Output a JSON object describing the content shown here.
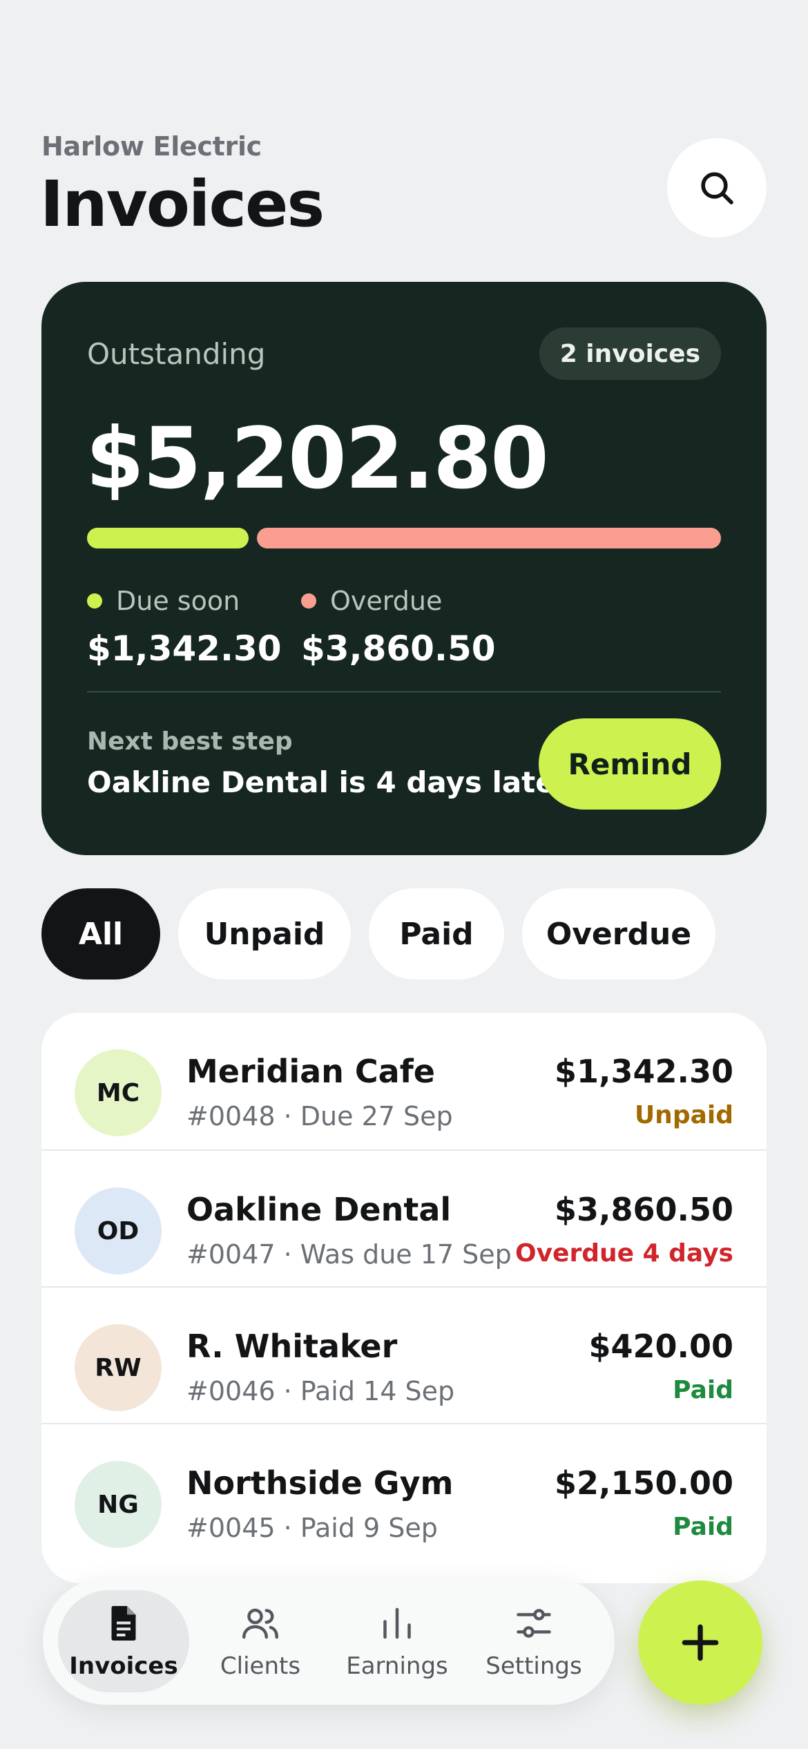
{
  "header": {
    "company": "Harlow Electric",
    "title": "Invoices",
    "search_icon": "search-icon"
  },
  "summary": {
    "label": "Outstanding",
    "badge": "2 invoices",
    "amount": "$5,202.80",
    "breakdown": [
      {
        "label": "Due soon",
        "value": "$1,342.30",
        "amount": 1342.3,
        "color": "#cdf14f"
      },
      {
        "label": "Overdue",
        "value": "$3,860.50",
        "amount": 3860.5,
        "color": "#fa9e92"
      }
    ],
    "next_label": "Next best step",
    "next_text": "Oakline Dental is 4 days late",
    "remind_label": "Remind"
  },
  "filters": [
    {
      "label": "All",
      "active": true
    },
    {
      "label": "Unpaid",
      "active": false
    },
    {
      "label": "Paid",
      "active": false
    },
    {
      "label": "Overdue",
      "active": false
    }
  ],
  "invoices": [
    {
      "initials": "MC",
      "avatar_color": "#e6f5c5",
      "name": "Meridian Cafe",
      "meta": "#0048 · Due 27 Sep",
      "amount": "$1,342.30",
      "status": "Unpaid",
      "status_color": "#a06a00"
    },
    {
      "initials": "OD",
      "avatar_color": "#dde8f6",
      "name": "Oakline Dental",
      "meta": "#0047 · Was due 17 Sep",
      "amount": "$3,860.50",
      "status": "Overdue 4 days",
      "status_color": "#d0252a"
    },
    {
      "initials": "RW",
      "avatar_color": "#f3e5d8",
      "name": "R. Whitaker",
      "meta": "#0046 · Paid 14 Sep",
      "amount": "$420.00",
      "status": "Paid",
      "status_color": "#1d8a3e"
    },
    {
      "initials": "NG",
      "avatar_color": "#e0f0e6",
      "name": "Northside Gym",
      "meta": "#0045 · Paid 9 Sep",
      "amount": "$2,150.00",
      "status": "Paid",
      "status_color": "#1d8a3e"
    }
  ],
  "nav": [
    {
      "label": "Invoices",
      "icon": "invoice-icon",
      "active": true
    },
    {
      "label": "Clients",
      "icon": "users-icon",
      "active": false
    },
    {
      "label": "Earnings",
      "icon": "bar-chart-icon",
      "active": false
    },
    {
      "label": "Settings",
      "icon": "sliders-icon",
      "active": false
    }
  ],
  "fab_icon": "plus-icon"
}
